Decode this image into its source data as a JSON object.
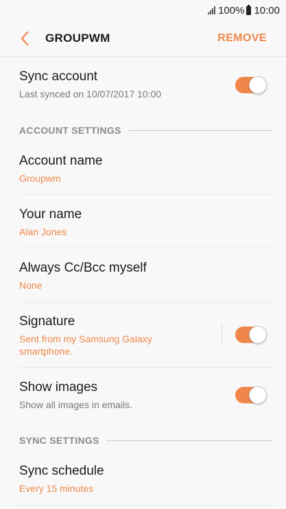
{
  "status_bar": {
    "battery": "100%",
    "time": "10:00"
  },
  "header": {
    "title": "GROUPWM",
    "remove_label": "REMOVE"
  },
  "sync_account": {
    "label": "Sync account",
    "sub": "Last synced on 10/07/2017  10:00",
    "enabled": true
  },
  "account_settings_header": "ACCOUNT SETTINGS",
  "account_name": {
    "label": "Account name",
    "value": "Groupwm"
  },
  "your_name": {
    "label": "Your name",
    "value": "Alan Jones"
  },
  "cc_bcc": {
    "label": "Always Cc/Bcc myself",
    "value": "None"
  },
  "signature": {
    "label": "Signature",
    "value_line1": "Sent from my Samsung Galaxy",
    "value_line2": "smartphone.",
    "enabled": true
  },
  "show_images": {
    "label": "Show images",
    "sub": "Show all images in emails.",
    "enabled": true
  },
  "sync_settings_header": "SYNC SETTINGS",
  "sync_schedule": {
    "label": "Sync schedule",
    "value": "Every 15 minutes"
  },
  "colors": {
    "accent": "#f0874a",
    "background": "#f8f8f8"
  }
}
